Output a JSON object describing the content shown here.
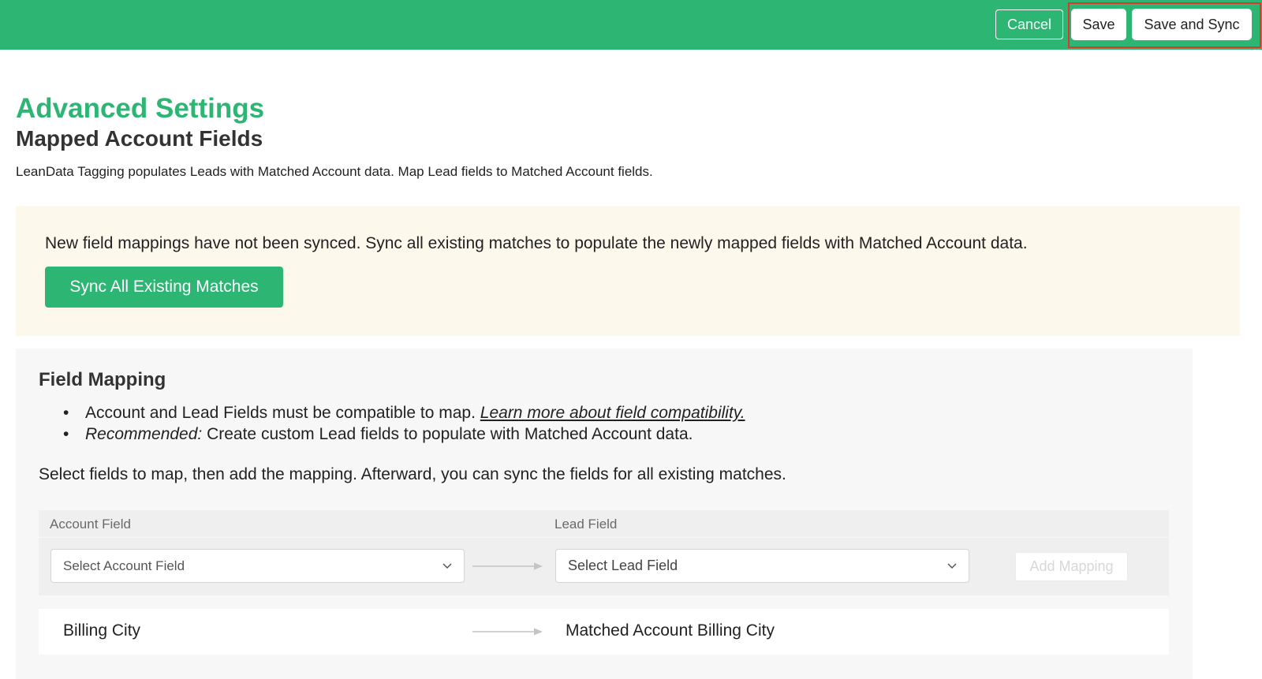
{
  "toolbar": {
    "cancel_label": "Cancel",
    "save_label": "Save",
    "save_sync_label": "Save and Sync"
  },
  "page": {
    "title": "Advanced Settings",
    "subtitle": "Mapped Account Fields",
    "description": "LeanData Tagging populates Leads with Matched Account data. Map Lead fields to Matched Account fields."
  },
  "notice": {
    "text": "New field mappings have not been synced. Sync all existing matches to populate the newly mapped fields with Matched Account data.",
    "button_label": "Sync All Existing Matches"
  },
  "field_mapping": {
    "heading": "Field Mapping",
    "bullet1_text": "Account and Lead Fields must be compatible to map. ",
    "bullet1_link": "Learn more about field compatibility.",
    "bullet2_em": "Recommended:",
    "bullet2_text": " Create custom Lead fields to populate with Matched Account data.",
    "instructions": "Select fields to map, then add the mapping. Afterward, you can sync the fields for all existing matches.",
    "account_field_header": "Account Field",
    "lead_field_header": "Lead Field",
    "account_select_placeholder": "Select Account Field",
    "lead_select_placeholder": "Select Lead Field",
    "add_mapping_label": "Add Mapping",
    "mappings": [
      {
        "account_field": "Billing City",
        "lead_field": "Matched Account Billing City"
      }
    ]
  },
  "colors": {
    "brand_green": "#2db673",
    "notice_bg": "#fdf8ec",
    "highlight_red": "#d93a2b"
  },
  "icons": [
    "chevron-down-icon",
    "right-arrow-icon"
  ]
}
